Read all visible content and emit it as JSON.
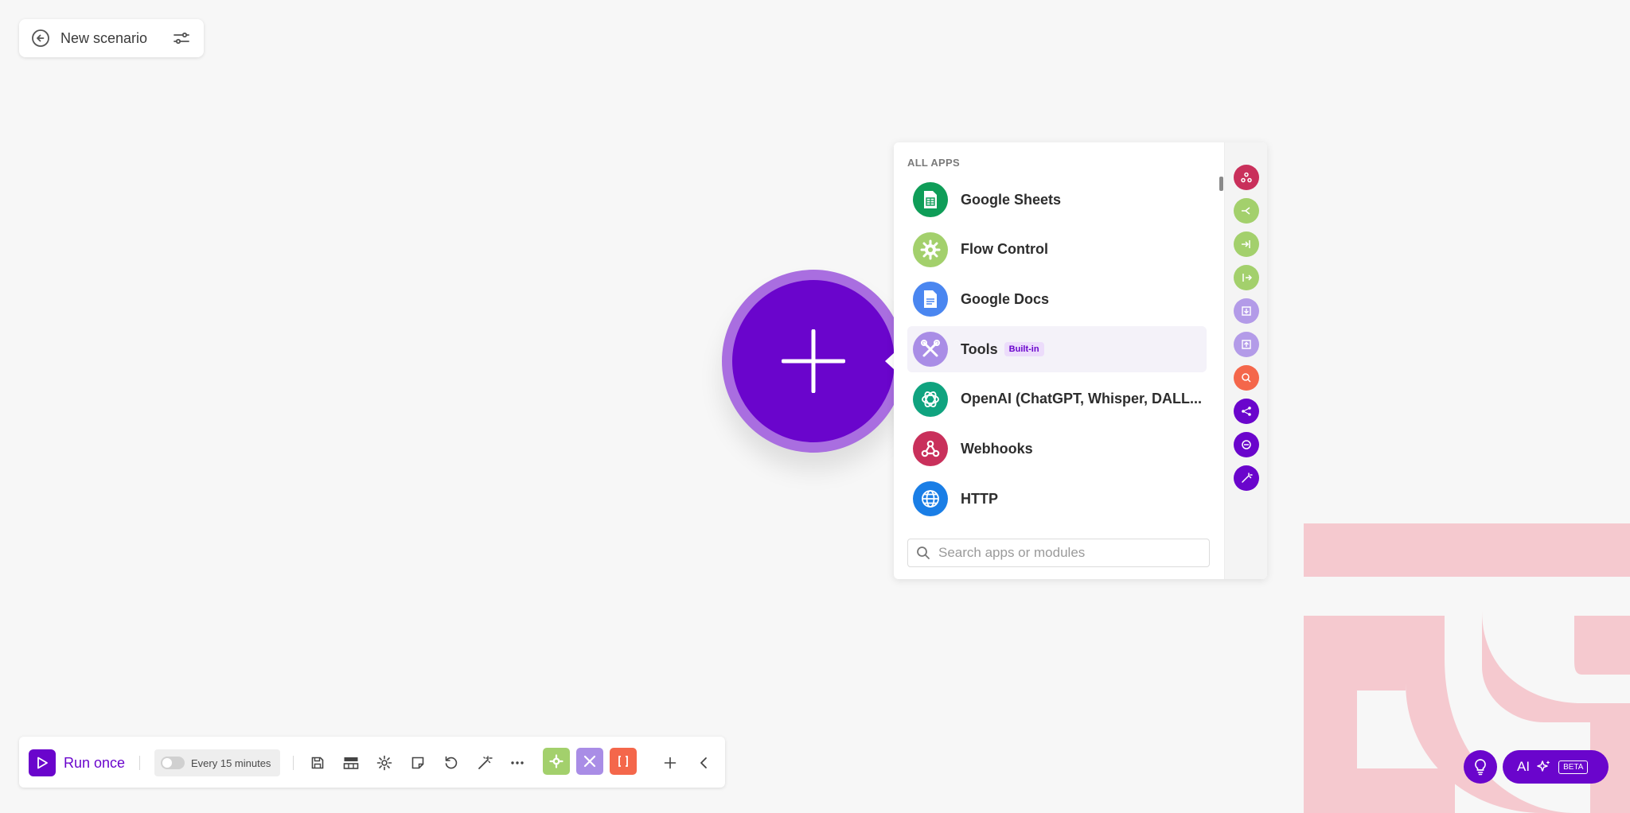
{
  "scenario": {
    "title": "New scenario"
  },
  "picker": {
    "section_title": "ALL APPS",
    "apps": [
      {
        "name": "Google Sheets",
        "icon": "google-sheets-icon",
        "color": "#0f9d58"
      },
      {
        "name": "Flow Control",
        "icon": "gear-icon",
        "color": "#a3d06c"
      },
      {
        "name": "Google Docs",
        "icon": "google-docs-icon",
        "color": "#4a86f0"
      },
      {
        "name": "Tools",
        "icon": "tools-icon",
        "color": "#a98de6",
        "badge": "Built-in"
      },
      {
        "name": "OpenAI (ChatGPT, Whisper, DALL...",
        "icon": "openai-icon",
        "color": "#10a37f"
      },
      {
        "name": "Webhooks",
        "icon": "webhooks-icon",
        "color": "#c9305b"
      },
      {
        "name": "HTTP",
        "icon": "globe-icon",
        "color": "#1a7ee6"
      }
    ],
    "search_placeholder": "Search apps or modules",
    "rail": [
      {
        "icon": "webhooks-icon",
        "color": "#c9305b"
      },
      {
        "icon": "router-icon",
        "color": "#a3d06c"
      },
      {
        "icon": "iterator-icon",
        "color": "#a3d06c"
      },
      {
        "icon": "aggregator-icon",
        "color": "#a3d06c"
      },
      {
        "icon": "download-icon",
        "color": "#b39be8"
      },
      {
        "icon": "upload-icon",
        "color": "#b39be8"
      },
      {
        "icon": "search-refresh-icon",
        "color": "#f4674b"
      },
      {
        "icon": "share-icon",
        "color": "#6a05cc"
      },
      {
        "icon": "openai-icon",
        "color": "#6a05cc"
      },
      {
        "icon": "magic-wand-icon",
        "color": "#6a05cc"
      }
    ]
  },
  "toolbar": {
    "run_label": "Run once",
    "schedule_label": "Every 15 minutes",
    "quick_buttons": [
      {
        "icon": "gear-icon",
        "color": "#a3d06c"
      },
      {
        "icon": "tools-icon",
        "color": "#a98de6"
      },
      {
        "icon": "json-brackets-icon",
        "color": "#f4674b"
      }
    ]
  },
  "ai": {
    "label": "AI",
    "badge": "BETA"
  },
  "colors": {
    "brand": "#6a05cc",
    "ring": "#a96ee0"
  }
}
